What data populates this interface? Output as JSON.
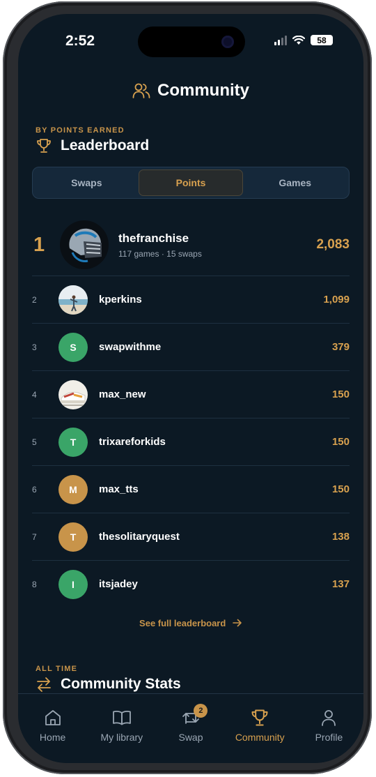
{
  "status_bar": {
    "time": "2:52",
    "battery": "58"
  },
  "header": {
    "title": "Community"
  },
  "leaderboard": {
    "eyebrow": "BY POINTS EARNED",
    "title": "Leaderboard",
    "tabs": [
      {
        "label": "Swaps",
        "active": false
      },
      {
        "label": "Points",
        "active": true
      },
      {
        "label": "Games",
        "active": false
      }
    ],
    "top": {
      "rank": "1",
      "username": "thefranchise",
      "subtitle": "117 games · 15 swaps",
      "points": "2,083",
      "avatar": "football-helmet-photo"
    },
    "rows": [
      {
        "rank": "2",
        "username": "kperkins",
        "points": "1,099",
        "avatar_type": "photo",
        "avatar": "beach-photo"
      },
      {
        "rank": "3",
        "username": "swapwithme",
        "points": "379",
        "avatar_type": "initial",
        "initial": "S",
        "color": "#3aa568"
      },
      {
        "rank": "4",
        "username": "max_new",
        "points": "150",
        "avatar_type": "photo",
        "avatar": "sneaker-photo"
      },
      {
        "rank": "5",
        "username": "trixareforkids",
        "points": "150",
        "avatar_type": "initial",
        "initial": "T",
        "color": "#3aa568"
      },
      {
        "rank": "6",
        "username": "max_tts",
        "points": "150",
        "avatar_type": "initial",
        "initial": "M",
        "color": "#c8944a"
      },
      {
        "rank": "7",
        "username": "thesolitaryquest",
        "points": "138",
        "avatar_type": "initial",
        "initial": "T",
        "color": "#c8944a"
      },
      {
        "rank": "8",
        "username": "itsjadey",
        "points": "137",
        "avatar_type": "initial",
        "initial": "I",
        "color": "#3aa568"
      }
    ],
    "see_full": "See full leaderboard"
  },
  "community_stats": {
    "eyebrow": "ALL TIME",
    "title": "Community Stats"
  },
  "tabbar": {
    "items": [
      {
        "label": "Home",
        "icon": "home-icon"
      },
      {
        "label": "My library",
        "icon": "book-icon"
      },
      {
        "label": "Swap",
        "icon": "swap-icon",
        "badge": "2"
      },
      {
        "label": "Community",
        "icon": "trophy-icon",
        "active": true
      },
      {
        "label": "Profile",
        "icon": "person-icon"
      }
    ]
  },
  "colors": {
    "accent": "#d8a14f",
    "background": "#0c1924",
    "green": "#3aa568"
  }
}
